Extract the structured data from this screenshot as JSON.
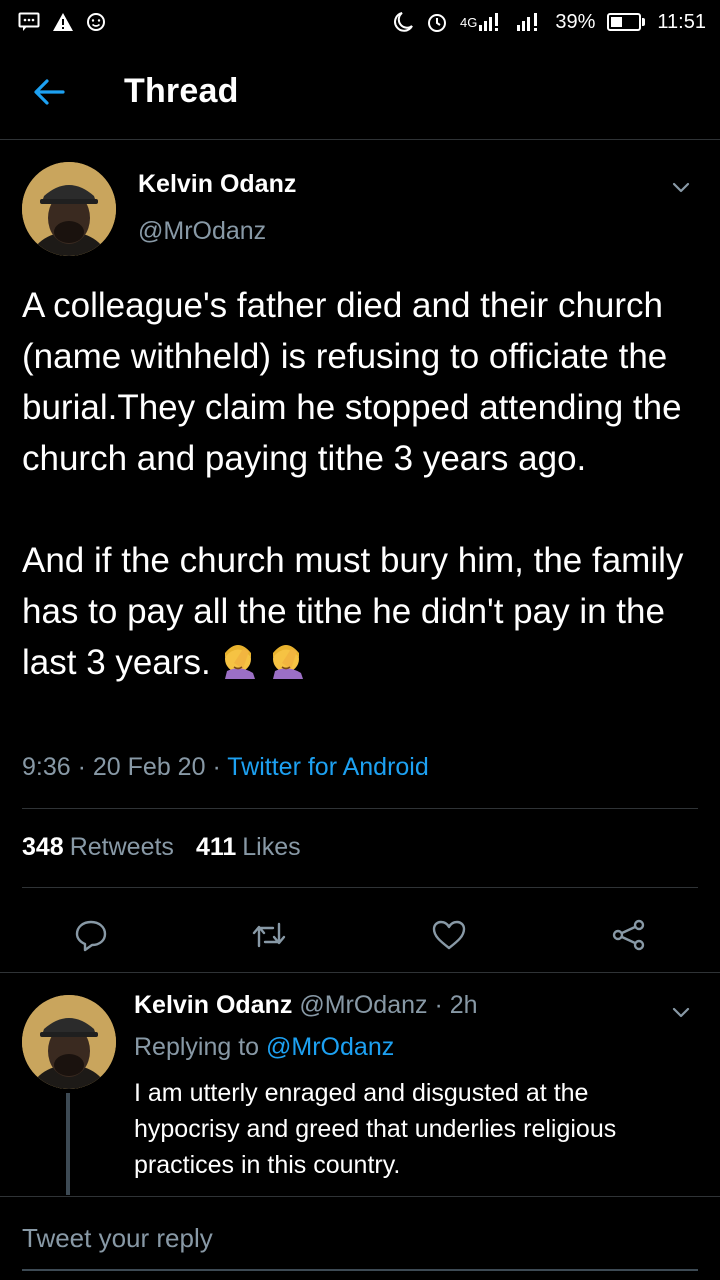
{
  "status_bar": {
    "icons_left": [
      "message-icon",
      "warning-icon",
      "face-icon"
    ],
    "network": "4G",
    "battery": "39%",
    "battery_level": 0.39,
    "time": "11:51"
  },
  "header": {
    "title": "Thread"
  },
  "tweet": {
    "author_name": "Kelvin Odanz",
    "author_handle": "@MrOdanz",
    "text": "A colleague's father died and their church (name withheld) is refusing to officiate the burial.They claim he stopped attending the church and paying tithe 3 years ago.\n\nAnd if the church must bury him, the family has to pay all the tithe he didn't pay in the last 3 years.",
    "emoji": [
      "face-palm-emoji",
      "face-palm-emoji"
    ],
    "time": "9:36",
    "date": "20 Feb 20",
    "source": "Twitter for Android",
    "retweets_count": "348",
    "retweets_label": "Retweets",
    "likes_count": "411",
    "likes_label": "Likes"
  },
  "reply": {
    "author_name": "Kelvin Odanz",
    "author_handle": "@MrOdanz",
    "age": "2h",
    "replying_to_label": "Replying to",
    "replying_to_handle": "@MrOdanz",
    "text": "I am utterly enraged and disgusted at the hypocrisy and greed that underlies religious practices in this country."
  },
  "compose": {
    "placeholder": "Tweet your reply"
  },
  "colors": {
    "background": "#000000",
    "accent": "#1da1f2",
    "secondary_text": "#8899a6",
    "divider": "#2f3336"
  }
}
